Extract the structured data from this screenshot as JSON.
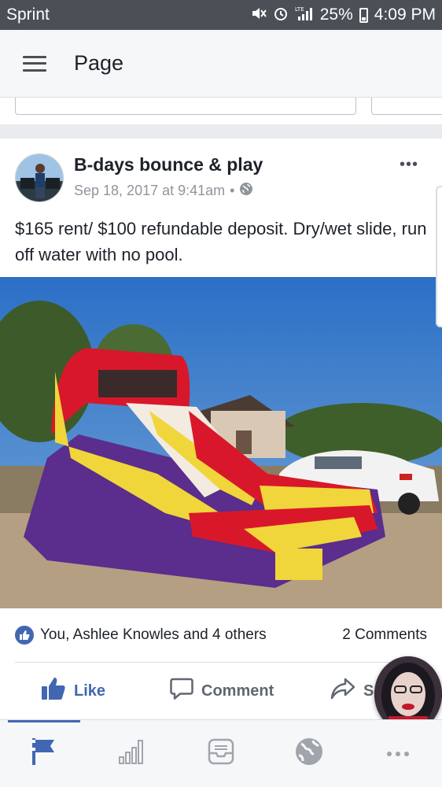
{
  "status_bar": {
    "carrier": "Sprint",
    "network": "LTE",
    "battery": "25%",
    "time": "4:09 PM"
  },
  "app_bar": {
    "title": "Page"
  },
  "post": {
    "page_name": "B-days bounce & play",
    "timestamp": "Sep 18, 2017 at 9:41am",
    "separator": "•",
    "privacy_icon": "globe-icon",
    "text": "$165 rent/ $100 refundable deposit.  Dry/wet slide, run off water with no pool.",
    "reactions_text": "You, Ashlee Knowles and 4 others",
    "comments_count": "2 Comments",
    "actions": {
      "like": "Like",
      "comment": "Comment",
      "share": "S"
    }
  },
  "bottom_nav": [
    {
      "icon": "flag-icon",
      "active": true
    },
    {
      "icon": "insights-icon",
      "active": false
    },
    {
      "icon": "inbox-icon",
      "active": false
    },
    {
      "icon": "globe-icon",
      "active": false
    },
    {
      "icon": "more-icon",
      "active": false
    }
  ],
  "colors": {
    "brand_blue": "#4267b2",
    "status_bar": "#4b4f56",
    "meta_gray": "#90949c"
  }
}
